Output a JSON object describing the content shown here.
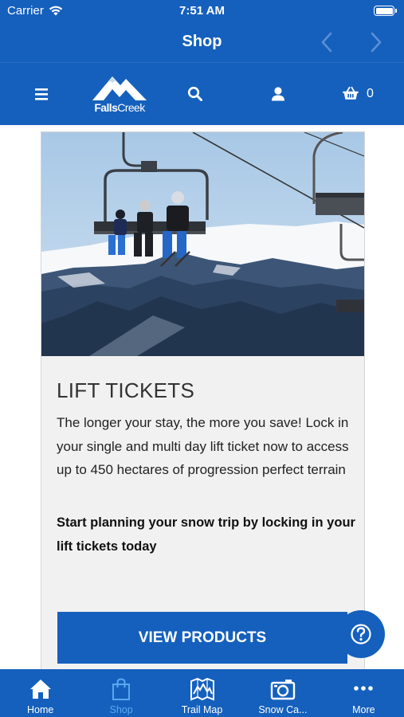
{
  "status_bar": {
    "carrier": "Carrier",
    "time": "7:51 AM"
  },
  "nav": {
    "title": "Shop"
  },
  "header": {
    "logo": {
      "brand_bold": "Falls",
      "brand_light": "Creek"
    },
    "cart_count": "0"
  },
  "card": {
    "title": "LIFT TICKETS",
    "description": "The longer your stay, the more you save! Lock in your single and multi day lift ticket now to access up to 450 hectares of progression perfect terrain",
    "cta_text": "Start planning your snow trip by locking in your lift tickets today"
  },
  "view_products_label": "VIEW PRODUCTS",
  "tabs": [
    {
      "label": "Home",
      "icon": "home-icon",
      "active": false
    },
    {
      "label": "Shop",
      "icon": "shopping-bag-icon",
      "active": true
    },
    {
      "label": "Trail Map",
      "icon": "trail-map-icon",
      "active": false
    },
    {
      "label": "Snow Ca...",
      "icon": "camera-icon",
      "active": false
    },
    {
      "label": "More",
      "icon": "more-icon",
      "active": false
    }
  ],
  "colors": {
    "brand_blue": "#1560bd",
    "active_tab": "#5aa8f0",
    "card_bg": "#f1f1f1"
  }
}
